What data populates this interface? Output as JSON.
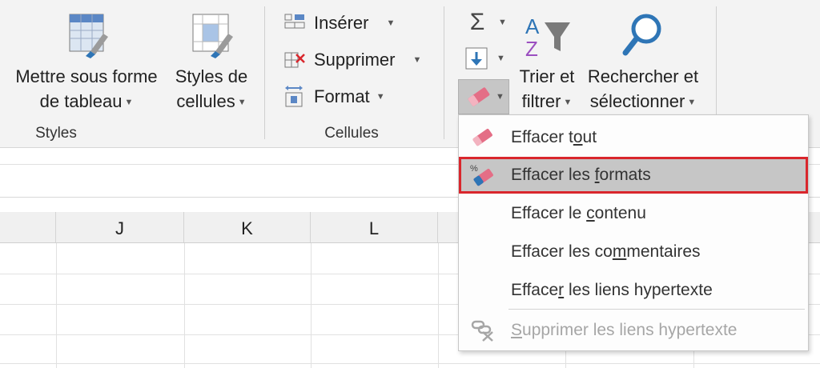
{
  "ribbon": {
    "styles_group": {
      "label": "Styles",
      "table_format": {
        "line1": "Mettre sous forme",
        "line2": "de tableau"
      },
      "cell_styles": {
        "line1": "Styles de",
        "line2": "cellules"
      }
    },
    "cells_group": {
      "label": "Cellules",
      "insert": "Insérer",
      "delete": "Supprimer",
      "format": "Format"
    },
    "editing_group": {
      "sort_filter": {
        "line1": "Trier et",
        "line2": "filtrer"
      },
      "find_select": {
        "line1": "Rechercher et",
        "line2": "sélectionner"
      }
    }
  },
  "columns": [
    "J",
    "K",
    "L"
  ],
  "clear_menu": {
    "items": [
      {
        "pre": "Effacer t",
        "key": "o",
        "post": "ut"
      },
      {
        "pre": "Effacer les ",
        "key": "f",
        "post": "ormats"
      },
      {
        "pre": "Effacer le ",
        "key": "c",
        "post": "ontenu"
      },
      {
        "pre": "Effacer les co",
        "key": "m",
        "post": "mentaires"
      },
      {
        "pre": "Efface",
        "key": "r",
        "post": " les liens hypertexte"
      },
      {
        "pre": "",
        "key": "S",
        "post": "upprimer les liens hypertexte"
      }
    ]
  },
  "colors": {
    "highlight_border": "#d9262c",
    "highlight_bg": "#c6c6c6",
    "eraser_pink": "#e46e86",
    "accent_blue": "#2e75b6"
  },
  "icons": [
    "table-format-icon",
    "cell-styles-icon",
    "insert-cells-icon",
    "delete-cells-icon",
    "format-cells-icon",
    "autosum-icon",
    "fill-down-icon",
    "eraser-icon",
    "sort-filter-icon",
    "find-icon",
    "clear-formats-icon",
    "remove-hyperlink-icon"
  ]
}
